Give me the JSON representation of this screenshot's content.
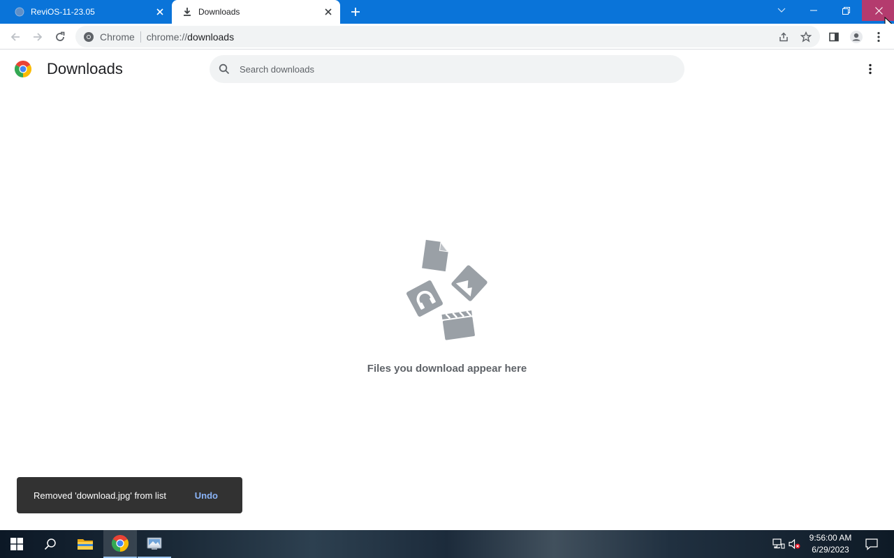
{
  "window": {
    "tabs": [
      {
        "label": "ReviOS-11-23.05",
        "icon": "globe-icon",
        "active": false
      },
      {
        "label": "Downloads",
        "icon": "download-icon",
        "active": true
      }
    ],
    "close_button_color": "#b43b6e"
  },
  "toolbar": {
    "site_chip_label": "Chrome",
    "url_scheme": "chrome://",
    "url_host": "downloads"
  },
  "page": {
    "title": "Downloads",
    "search_placeholder": "Search downloads",
    "empty_message": "Files you download appear here"
  },
  "toast": {
    "message": "Removed 'download.jpg' from list",
    "action_label": "Undo"
  },
  "taskbar": {
    "time": "9:56:00 AM",
    "date": "6/29/2023",
    "pinned": [
      "windows-start-icon",
      "search-icon",
      "file-explorer-icon",
      "chrome-icon",
      "app-icon"
    ]
  },
  "colors": {
    "title_bar": "#0a74d9",
    "accent_link": "#8ab4f8",
    "toast_bg": "#323232"
  }
}
